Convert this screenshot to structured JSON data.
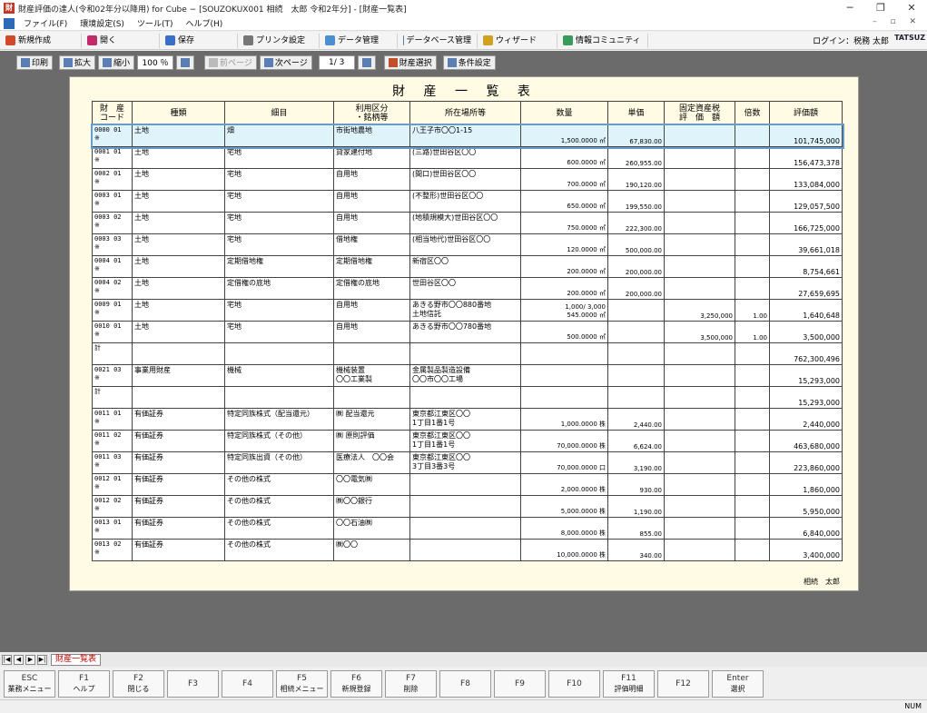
{
  "window": {
    "title": "財産評価の達人(令和02年分以降用) for Cube − [SOUZOKUX001 相続　太郎 令和2年分] - [財産一覧表]"
  },
  "menu": [
    "ファイル(F)",
    "環境設定(S)",
    "ツール(T)",
    "ヘルプ(H)"
  ],
  "toolbar": {
    "buttons": [
      "新規作成",
      "開く",
      "保存",
      "プリンタ設定",
      "データ管理",
      "データベース管理",
      "ウィザード",
      "情報コミュニティ"
    ],
    "login": "ログイン：税務 太郎",
    "logo": "TATSUZ"
  },
  "viewer": {
    "print": "印刷",
    "zoom_in": "拡大",
    "zoom_out": "縮小",
    "zoom": "100 ％",
    "prev": "前ページ",
    "next": "次ページ",
    "page": "1/ 3",
    "select": "財産選択",
    "condition": "条件設定"
  },
  "report": {
    "title": "財 産 一 覧 表",
    "columns": [
      "財　産\nコード",
      "種類",
      "細目",
      "利用区分\n・銘柄等",
      "所在場所等",
      "数量",
      "単価",
      "固定資産税\n評　価　額",
      "倍数",
      "評価額"
    ],
    "rows": [
      {
        "code": "0000 01\n※",
        "kind": "土地",
        "detail": "畑",
        "use": "市街地農地",
        "loc": "八王子市〇〇1-15",
        "qty": "1,500.0000 ㎡",
        "price": "67,830.00",
        "tax": "",
        "mult": "",
        "value": "101,745,000",
        "selected": true
      },
      {
        "code": "0001 01\n※",
        "kind": "土地",
        "detail": "宅地",
        "use": "貸家建付地",
        "loc": "(三路)世田谷区〇〇",
        "qty": "600.0000 ㎡",
        "price": "260,955.00",
        "tax": "",
        "mult": "",
        "value": "156,473,378"
      },
      {
        "code": "0002 01\n※",
        "kind": "土地",
        "detail": "宅地",
        "use": "自用地",
        "loc": "(間口)世田谷区〇〇",
        "qty": "700.0000 ㎡",
        "price": "190,120.00",
        "tax": "",
        "mult": "",
        "value": "133,084,000"
      },
      {
        "code": "0003 01\n※",
        "kind": "土地",
        "detail": "宅地",
        "use": "自用地",
        "loc": "(不整形)世田谷区〇〇",
        "qty": "650.0000 ㎡",
        "price": "199,550.00",
        "tax": "",
        "mult": "",
        "value": "129,057,500"
      },
      {
        "code": "0003 02\n※",
        "kind": "土地",
        "detail": "宅地",
        "use": "自用地",
        "loc": "(地積規模大)世田谷区〇〇",
        "qty": "750.0000 ㎡",
        "price": "222,300.00",
        "tax": "",
        "mult": "",
        "value": "166,725,000"
      },
      {
        "code": "0003 03\n※",
        "kind": "土地",
        "detail": "宅地",
        "use": "借地権",
        "loc": "(相当地代)世田谷区〇〇",
        "qty": "120.0000 ㎡",
        "price": "500,000.00",
        "tax": "",
        "mult": "",
        "value": "39,661,018"
      },
      {
        "code": "0004 01\n※",
        "kind": "土地",
        "detail": "定期借地権",
        "use": "定期借地権",
        "loc": "新宿区〇〇",
        "qty": "200.0000 ㎡",
        "price": "200,000.00",
        "tax": "",
        "mult": "",
        "value": "8,754,661"
      },
      {
        "code": "0004 02\n※",
        "kind": "土地",
        "detail": "定借権の底地",
        "use": "定借権の底地",
        "loc": "世田谷区〇〇",
        "qty": "200.0000 ㎡",
        "price": "200,000.00",
        "tax": "",
        "mult": "",
        "value": "27,659,695"
      },
      {
        "code": "0009 01\n※",
        "kind": "土地",
        "detail": "宅地",
        "use": "自用地",
        "loc": "あきる野市〇〇880番地\n土地信託",
        "qty": "1,000/ 3,000\n545.0000 ㎡",
        "price": "",
        "tax": "3,250,000",
        "mult": "1.00",
        "value": "1,640,648"
      },
      {
        "code": "0010 01\n※",
        "kind": "土地",
        "detail": "宅地",
        "use": "自用地",
        "loc": "あきる野市〇〇780番地",
        "qty": "500.0000 ㎡",
        "price": "",
        "tax": "3,500,000",
        "mult": "1.00",
        "value": "3,500,000"
      },
      {
        "code": "計",
        "kind": "",
        "detail": "",
        "use": "",
        "loc": "",
        "qty": "",
        "price": "",
        "tax": "",
        "mult": "",
        "value": "762,300,496"
      },
      {
        "code": "0021 03\n※",
        "kind": "事業用財産",
        "detail": "機械",
        "use": "機械装置\n〇〇工業製",
        "loc": "金属製品製造設備\n〇〇市〇〇工場",
        "qty": "",
        "price": "",
        "tax": "",
        "mult": "",
        "value": "15,293,000"
      },
      {
        "code": "計",
        "kind": "",
        "detail": "",
        "use": "",
        "loc": "",
        "qty": "",
        "price": "",
        "tax": "",
        "mult": "",
        "value": "15,293,000"
      },
      {
        "code": "0011 01\n※",
        "kind": "有価証券",
        "detail": "特定同族株式（配当還元）",
        "use": "㈱ 配当還元",
        "loc": "東京都江東区〇〇\n1丁目1番1号",
        "qty": "1,000.0000 株",
        "price": "2,440.00",
        "tax": "",
        "mult": "",
        "value": "2,440,000"
      },
      {
        "code": "0011 02\n※",
        "kind": "有価証券",
        "detail": "特定同族株式（その他）",
        "use": "㈱ 原則評価",
        "loc": "東京都江東区〇〇\n1丁目1番1号",
        "qty": "70,000.0000 株",
        "price": "6,624.00",
        "tax": "",
        "mult": "",
        "value": "463,680,000"
      },
      {
        "code": "0011 03\n※",
        "kind": "有価証券",
        "detail": "特定同族出資（その他）",
        "use": "医療法人　〇〇会",
        "loc": "東京都江東区〇〇\n3丁目3番3号",
        "qty": "70,000.0000 口",
        "price": "3,190.00",
        "tax": "",
        "mult": "",
        "value": "223,860,000"
      },
      {
        "code": "0012 01\n※",
        "kind": "有価証券",
        "detail": "その他の株式",
        "use": "〇〇電気㈱",
        "loc": "",
        "qty": "2,000.0000 株",
        "price": "930.00",
        "tax": "",
        "mult": "",
        "value": "1,860,000"
      },
      {
        "code": "0012 02\n※",
        "kind": "有価証券",
        "detail": "その他の株式",
        "use": "㈱〇〇銀行",
        "loc": "",
        "qty": "5,000.0000 株",
        "price": "1,190.00",
        "tax": "",
        "mult": "",
        "value": "5,950,000"
      },
      {
        "code": "0013 01\n※",
        "kind": "有価証券",
        "detail": "その他の株式",
        "use": "〇〇石油㈱",
        "loc": "",
        "qty": "8,000.0000 株",
        "price": "855.00",
        "tax": "",
        "mult": "",
        "value": "6,840,000"
      },
      {
        "code": "0013 02\n※",
        "kind": "有価証券",
        "detail": "その他の株式",
        "use": "㈱〇〇",
        "loc": "",
        "qty": "10,000.0000 株",
        "price": "340.00",
        "tax": "",
        "mult": "",
        "value": "3,400,000"
      }
    ],
    "footer": "相続　太郎"
  },
  "tabs": {
    "active": "財産一覧表"
  },
  "fkeys": [
    {
      "key": "ESC",
      "label": "業務メニュー"
    },
    {
      "key": "F1",
      "label": "ヘルプ"
    },
    {
      "key": "F2",
      "label": "閉じる"
    },
    {
      "key": "F3",
      "label": ""
    },
    {
      "key": "F4",
      "label": ""
    },
    {
      "key": "F5",
      "label": "相続メニュー"
    },
    {
      "key": "F6",
      "label": "新規登録"
    },
    {
      "key": "F7",
      "label": "削除"
    },
    {
      "key": "F8",
      "label": ""
    },
    {
      "key": "F9",
      "label": ""
    },
    {
      "key": "F10",
      "label": ""
    },
    {
      "key": "F11",
      "label": "評価明細"
    },
    {
      "key": "F12",
      "label": ""
    },
    {
      "key": "Enter",
      "label": "選択"
    }
  ],
  "status": {
    "num": "NUM"
  }
}
